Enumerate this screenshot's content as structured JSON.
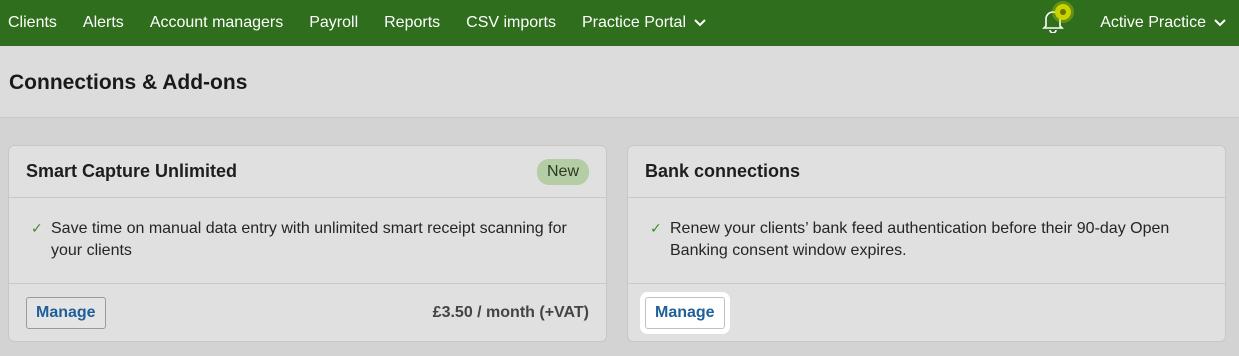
{
  "nav": {
    "items": [
      {
        "label": "Clients"
      },
      {
        "label": "Alerts"
      },
      {
        "label": "Account managers"
      },
      {
        "label": "Payroll"
      },
      {
        "label": "Reports"
      },
      {
        "label": "CSV imports"
      },
      {
        "label": "Practice Portal"
      }
    ],
    "practice_label": "Active Practice"
  },
  "page": {
    "title": "Connections & Add-ons"
  },
  "cards": [
    {
      "title": "Smart Capture Unlimited",
      "badge": "New",
      "feature": "Save time on manual data entry with unlimited smart receipt scanning for your clients",
      "button": "Manage",
      "price": "£3.50 / month (+VAT)"
    },
    {
      "title": "Bank connections",
      "feature": "Renew your clients’ bank feed authentication before their 90-day Open Banking consent window expires.",
      "button": "Manage"
    }
  ],
  "colors": {
    "nav_bg": "#2e6e1c",
    "badge_bg": "#b4cda5",
    "link_blue": "#1f5f9a",
    "check_green": "#3f8a2a"
  },
  "icons": {
    "dropdown": "chevron-down-icon",
    "notifications": "bell-icon",
    "check": "check-icon"
  }
}
